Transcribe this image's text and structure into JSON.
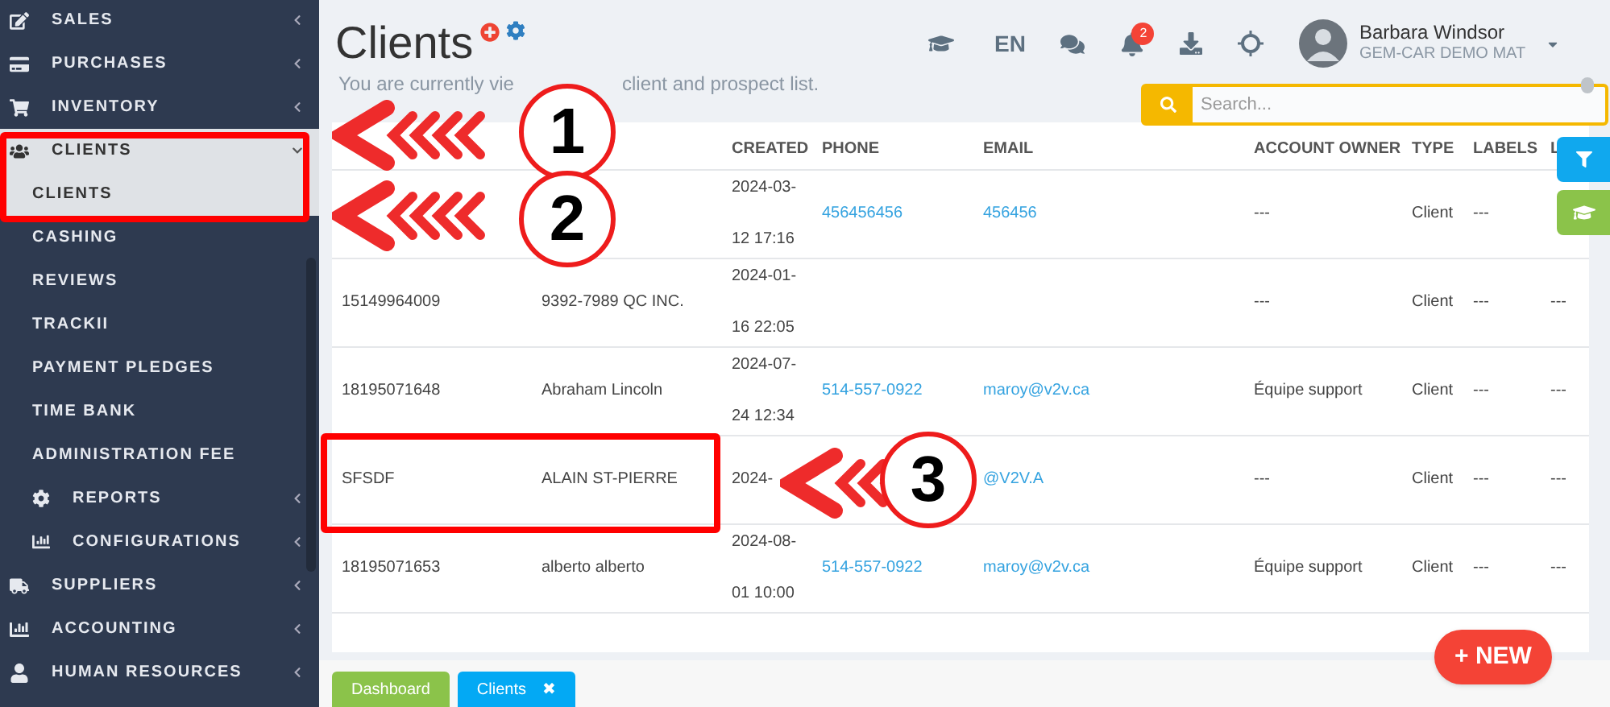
{
  "sidebar": {
    "items": [
      {
        "kind": "group",
        "label": "SALES",
        "expanded": false
      },
      {
        "kind": "group",
        "label": "PURCHASES",
        "expanded": false
      },
      {
        "kind": "group",
        "label": "INVENTORY",
        "expanded": false
      },
      {
        "kind": "group",
        "label": "CLIENTS",
        "expanded": true,
        "children": [
          {
            "kind": "link",
            "label": "CLIENTS",
            "selected": true
          },
          {
            "kind": "link",
            "label": "CASHING",
            "selected": false
          },
          {
            "kind": "link",
            "label": "REVIEWS",
            "selected": false
          },
          {
            "kind": "link",
            "label": "TRACKII",
            "selected": false
          },
          {
            "kind": "link",
            "label": "PAYMENT PLEDGES",
            "selected": false
          },
          {
            "kind": "link",
            "label": "TIME BANK",
            "selected": false
          },
          {
            "kind": "link",
            "label": "ADMINISTRATION FEE",
            "selected": false
          },
          {
            "kind": "group",
            "label": "REPORTS",
            "expanded": false
          },
          {
            "kind": "group",
            "label": "CONFIGURATIONS",
            "expanded": false
          }
        ]
      },
      {
        "kind": "group",
        "label": "SUPPLIERS",
        "expanded": false
      },
      {
        "kind": "group",
        "label": "ACCOUNTING",
        "expanded": false
      },
      {
        "kind": "group",
        "label": "HUMAN RESOURCES",
        "expanded": false
      }
    ]
  },
  "page": {
    "title": "Clients",
    "subtitle_parts": [
      "You are currently vie",
      "client and prospect list."
    ]
  },
  "topbar": {
    "language": "EN",
    "notifications": "2",
    "user": {
      "name": "Barbara Windsor",
      "company": "GEM-CAR DEMO MAT"
    }
  },
  "search": {
    "placeholder": "Search..."
  },
  "table": {
    "columns": [
      "",
      "",
      "CREATED",
      "PHONE",
      "EMAIL",
      "ACCOUNT OWNER",
      "TYPE",
      "LABELS",
      "L"
    ],
    "rows": [
      {
        "created": "2024-03-12 17:16",
        "phone": "456456456",
        "email": "456456",
        "owner": "---",
        "type": "Client",
        "labels": "---"
      },
      {
        "id": "15149964009",
        "name": "9392-7989 QC INC.",
        "created": "2024-01-16 22:05",
        "owner": "---",
        "type": "Client",
        "labels": "---",
        "column_9": "---"
      },
      {
        "id": "18195071648",
        "name": "Abraham Lincoln",
        "created": "2024-07-24 12:34",
        "phone": "514-557-0922",
        "email": "maroy@v2v.ca",
        "owner": "Équipe support",
        "type": "Client",
        "labels": "---",
        "column_9": "---"
      },
      {
        "id": "SFSDF",
        "name": "ALAIN ST-PIERRE",
        "created": "2024-",
        "email": "@V2V.A",
        "owner": "---",
        "type": "Client",
        "labels": "---",
        "column_9": "---"
      },
      {
        "id": "18195071653",
        "name": "alberto alberto",
        "created": "2024-08-01 10:00",
        "phone": "514-557-0922",
        "email": "maroy@v2v.ca",
        "owner": "Équipe support",
        "type": "Client",
        "labels": "---",
        "column_9": "---"
      }
    ]
  },
  "new_button": "+ NEW",
  "bottom_tabs": [
    {
      "label": "Dashboard",
      "kind": "plain",
      "color": "#8bc34a"
    },
    {
      "label": "Clients",
      "kind": "closable",
      "close": "✖",
      "color": "#03a9f4"
    }
  ],
  "annotations": [
    {
      "number": "1"
    },
    {
      "number": "2"
    },
    {
      "number": "3"
    }
  ]
}
